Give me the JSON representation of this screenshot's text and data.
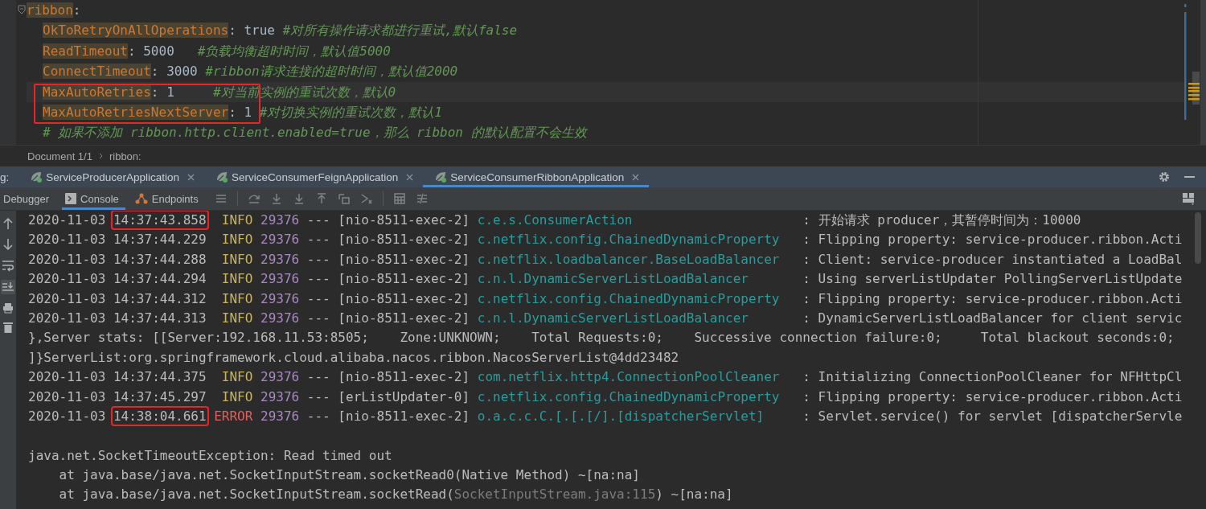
{
  "editor": {
    "lines": [
      {
        "kind": "section",
        "key": "ribbon",
        "value": ":",
        "children": [
          {
            "kind": "entry",
            "key": "OkToRetryOnAllOperations",
            "value": ": true",
            "comment": " #对所有操作请求都进行重试,默认false",
            "current": false,
            "boxed": false
          },
          {
            "kind": "entry",
            "key": "ReadTimeout",
            "value": ": 5000",
            "comment": "   #负载均衡超时时间，默认值5000",
            "current": false,
            "boxed": false
          },
          {
            "kind": "entry",
            "key": "ConnectTimeout",
            "value": ": 3000",
            "comment": " #ribbon请求连接的超时时间，默认值2000",
            "current": false,
            "boxed": false
          },
          {
            "kind": "entry",
            "key": "MaxAutoRetries",
            "value": ": 1",
            "comment": "     #对当前实例的重试次数，默认0",
            "current": true,
            "boxed": true
          },
          {
            "kind": "entry",
            "key": "MaxAutoRetriesNextServer",
            "value": ": 1",
            "comment": " #对切换实例的重试次数，默认1",
            "current": false,
            "boxed": true
          },
          {
            "kind": "comment",
            "comment": "# 如果不添加 ribbon.http.client.enabled=true，那么 ribbon 的默认配置不会生效",
            "current": false,
            "boxed": false
          }
        ]
      }
    ]
  },
  "breadcrumb": [
    "Document 1/1",
    "ribbon:"
  ],
  "run_tabs": {
    "prefix": "g:",
    "tabs": [
      {
        "label": "ServiceProducerApplication",
        "selected": false
      },
      {
        "label": "ServiceConsumerFeignApplication",
        "selected": false
      },
      {
        "label": "ServiceConsumerRibbonApplication",
        "selected": true
      }
    ]
  },
  "console_tabs": [
    {
      "kind": "plain",
      "label": "Debugger",
      "selected": false
    },
    {
      "kind": "console",
      "label": "Console",
      "selected": true
    },
    {
      "kind": "endpoints",
      "label": "Endpoints",
      "selected": false
    }
  ],
  "console": {
    "soft_wrap_on": false,
    "scroll_to_end_on": true,
    "lines": [
      {
        "kind": "log",
        "date": "2020-11-03",
        "time": "14:37:43.858",
        "boxed": true,
        "level": "INFO",
        "pid": "29376",
        "sep": "---",
        "thread": "[nio-8511-exec-2]",
        "logger": "c.e.s.ConsumerAction",
        "message": ": 开始请求 producer，其暂停时间为：10000"
      },
      {
        "kind": "log",
        "date": "2020-11-03",
        "time": "14:37:44.229",
        "boxed": false,
        "level": "INFO",
        "pid": "29376",
        "sep": "---",
        "thread": "[nio-8511-exec-2]",
        "logger": "c.netflix.config.ChainedDynamicProperty",
        "message": ": Flipping property: service-producer.ribbon.Acti"
      },
      {
        "kind": "log",
        "date": "2020-11-03",
        "time": "14:37:44.288",
        "boxed": false,
        "level": "INFO",
        "pid": "29376",
        "sep": "---",
        "thread": "[nio-8511-exec-2]",
        "logger": "c.netflix.loadbalancer.BaseLoadBalancer",
        "message": ": Client: service-producer instantiated a LoadBal"
      },
      {
        "kind": "log",
        "date": "2020-11-03",
        "time": "14:37:44.294",
        "boxed": false,
        "level": "INFO",
        "pid": "29376",
        "sep": "---",
        "thread": "[nio-8511-exec-2]",
        "logger": "c.n.l.DynamicServerListLoadBalancer",
        "message": ": Using serverListUpdater PollingServerListUpdate"
      },
      {
        "kind": "log",
        "date": "2020-11-03",
        "time": "14:37:44.312",
        "boxed": false,
        "level": "INFO",
        "pid": "29376",
        "sep": "---",
        "thread": "[nio-8511-exec-2]",
        "logger": "c.netflix.config.ChainedDynamicProperty",
        "message": ": Flipping property: service-producer.ribbon.Acti"
      },
      {
        "kind": "log",
        "date": "2020-11-03",
        "time": "14:37:44.313",
        "boxed": false,
        "level": "INFO",
        "pid": "29376",
        "sep": "---",
        "thread": "[nio-8511-exec-2]",
        "logger": "c.n.l.DynamicServerListLoadBalancer",
        "message": ": DynamicServerListLoadBalancer for client servic"
      },
      {
        "kind": "text",
        "text": "},Server stats: [[Server:192.168.11.53:8505;    Zone:UNKNOWN;    Total Requests:0;    Successive connection failure:0;     Total blackout seconds:0;"
      },
      {
        "kind": "text",
        "text": "]}ServerList:org.springframework.cloud.alibaba.nacos.ribbon.NacosServerList@4dd23482"
      },
      {
        "kind": "log",
        "date": "2020-11-03",
        "time": "14:37:44.375",
        "boxed": false,
        "level": "INFO",
        "pid": "29376",
        "sep": "---",
        "thread": "[nio-8511-exec-2]",
        "logger": "com.netflix.http4.ConnectionPoolCleaner",
        "message": ": Initializing ConnectionPoolCleaner for NFHttpCl"
      },
      {
        "kind": "log",
        "date": "2020-11-03",
        "time": "14:37:45.297",
        "boxed": false,
        "level": "INFO",
        "pid": "29376",
        "sep": "---",
        "thread": "[erListUpdater-0]",
        "logger": "c.netflix.config.ChainedDynamicProperty",
        "message": ": Flipping property: service-producer.ribbon.Acti"
      },
      {
        "kind": "log",
        "date": "2020-11-03",
        "time": "14:38:04.661",
        "boxed": true,
        "level": "ERROR",
        "pid": "29376",
        "sep": "---",
        "thread": "[nio-8511-exec-2]",
        "logger": "o.a.c.c.C.[.[.[/].[dispatcherServlet]",
        "message": ": Servlet.service() for servlet [dispatcherServle"
      },
      {
        "kind": "blank"
      },
      {
        "kind": "text",
        "text": "java.net.SocketTimeoutException: Read timed out"
      },
      {
        "kind": "stack",
        "text": "at java.base/java.net.SocketInputStream.socketRead0(Native Method) ~[na:na]"
      },
      {
        "kind": "stack",
        "text": "at java.base/java.net.SocketInputStream.socketRead(",
        "link": "SocketInputStream.java:115",
        "after": ") ~[na:na]"
      }
    ]
  }
}
